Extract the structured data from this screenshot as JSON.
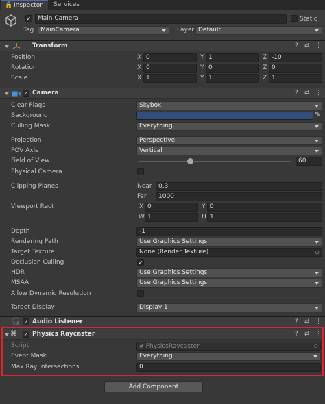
{
  "tabs": [
    "Inspector",
    "Services"
  ],
  "gameobject": {
    "name": "Main Camera",
    "static_label": "Static",
    "tag_label": "Tag",
    "tag_value": "MainCamera",
    "layer_label": "Layer",
    "layer_value": "Default"
  },
  "transform": {
    "title": "Transform",
    "position_label": "Position",
    "rotation_label": "Rotation",
    "scale_label": "Scale",
    "position": {
      "x": "0",
      "y": "1",
      "z": "-10"
    },
    "rotation": {
      "x": "0",
      "y": "0",
      "z": "0"
    },
    "scale": {
      "x": "1",
      "y": "1",
      "z": "1"
    }
  },
  "camera": {
    "title": "Camera",
    "clear_flags_label": "Clear Flags",
    "clear_flags": "Skybox",
    "background_label": "Background",
    "background_color": "#314D79",
    "culling_mask_label": "Culling Mask",
    "culling_mask": "Everything",
    "projection_label": "Projection",
    "projection": "Perspective",
    "fov_axis_label": "FOV Axis",
    "fov_axis": "Vertical",
    "fov_label": "Field of View",
    "fov": "60",
    "physical_camera_label": "Physical Camera",
    "clipping_label": "Clipping Planes",
    "near_label": "Near",
    "near": "0.3",
    "far_label": "Far",
    "far": "1000",
    "viewport_label": "Viewport Rect",
    "vp_x": "0",
    "vp_y": "0",
    "vp_w": "1",
    "vp_h": "1",
    "depth_label": "Depth",
    "depth": "-1",
    "rendering_path_label": "Rendering Path",
    "rendering_path": "Use Graphics Settings",
    "target_texture_label": "Target Texture",
    "target_texture": "None (Render Texture)",
    "occlusion_label": "Occlusion Culling",
    "hdr_label": "HDR",
    "hdr": "Use Graphics Settings",
    "msaa_label": "MSAA",
    "msaa": "Use Graphics Settings",
    "dynres_label": "Allow Dynamic Resolution",
    "target_display_label": "Target Display",
    "target_display": "Display 1"
  },
  "audio_listener": {
    "title": "Audio Listener"
  },
  "physics_raycaster": {
    "title": "Physics Raycaster",
    "script_label": "Script",
    "script": "PhysicsRaycaster",
    "event_mask_label": "Event Mask",
    "event_mask": "Everything",
    "max_ray_label": "Max Ray Intersections",
    "max_ray": "0"
  },
  "add_component": "Add Component",
  "axis": {
    "x": "X",
    "y": "Y",
    "z": "Z",
    "w": "W",
    "h": "H"
  },
  "icons": {
    "help": "?",
    "preset": "⇄",
    "menu": "⋮",
    "check": "✓"
  }
}
